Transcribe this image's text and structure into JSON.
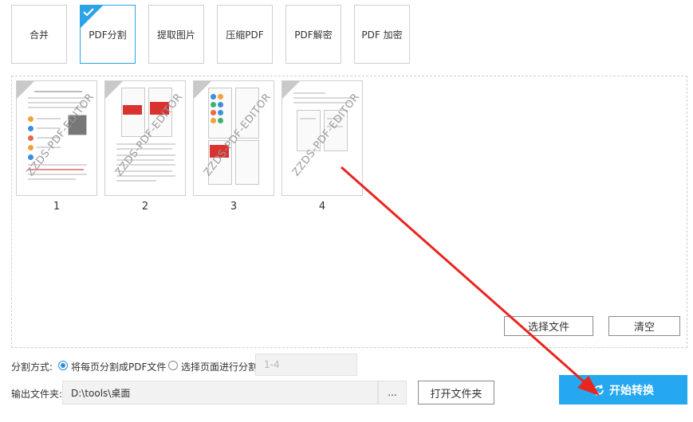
{
  "tools": [
    {
      "label": "合并"
    },
    {
      "label": "PDF分割"
    },
    {
      "label": "提取图片"
    },
    {
      "label": "压缩PDF"
    },
    {
      "label": "PDF解密"
    },
    {
      "label": "PDF 加密"
    }
  ],
  "pages": [
    {
      "number": "1",
      "watermark": "ZZDS-PDF-EDITOR"
    },
    {
      "number": "2",
      "watermark": "ZZDS-PDF-EDITOR"
    },
    {
      "number": "3",
      "watermark": "ZZDS-PDF-EDITOR"
    },
    {
      "number": "4",
      "watermark": "ZZDS-PDF-EDITOR"
    }
  ],
  "panel_buttons": {
    "select_file": "选择文件",
    "clear": "清空"
  },
  "split": {
    "label": "分割方式:",
    "option_each_page": "将每页分割成PDF文件",
    "option_range": "选择页面进行分割",
    "range_value": "1-4"
  },
  "output": {
    "label": "输出文件夹:",
    "path": "D:\\tools\\桌面",
    "browse": "...",
    "open_folder": "打开文件夹"
  },
  "start_button": "开始转换",
  "colors": {
    "accent": "#2ba3e6",
    "start_bg": "#25a8ef",
    "arrow": "#e8251f"
  }
}
